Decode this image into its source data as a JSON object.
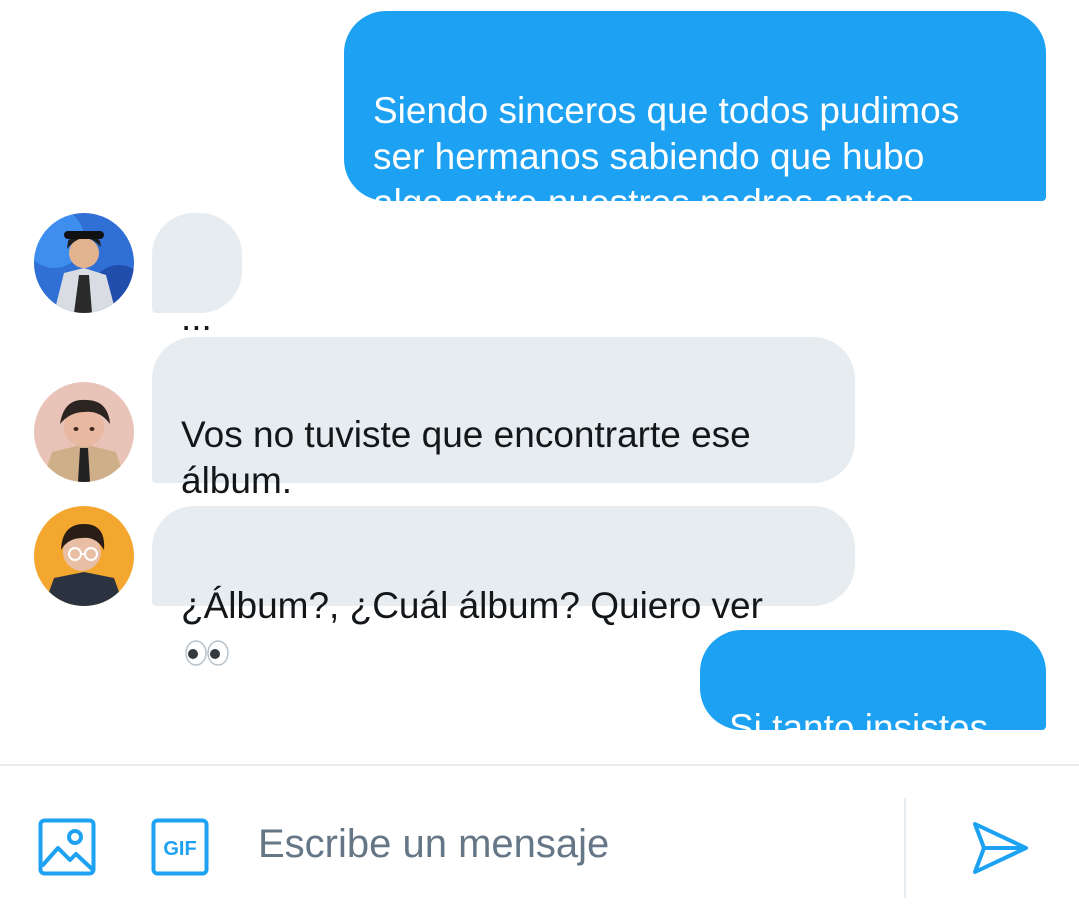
{
  "conversation": {
    "messages": [
      {
        "direction": "outgoing",
        "text": "Siendo sinceros que todos pudimos\nser hermanos sabiendo que hubo\nalgo entre nuestros padres antes."
      },
      {
        "direction": "incoming",
        "avatar": "avatar-blue-coat-character",
        "text": "..."
      },
      {
        "direction": "incoming",
        "avatar": "avatar-beige-jacket-character",
        "text": "Vos no tuviste que encontrarte ese\nálbum."
      },
      {
        "direction": "incoming",
        "avatar": "avatar-orange-glasses-character",
        "text": "¿Álbum?, ¿Cuál álbum? Quiero ver",
        "emoji": "eyes-emoji"
      },
      {
        "direction": "outgoing",
        "text": "Si tanto insistes."
      }
    ]
  },
  "composer": {
    "image_icon": "image-icon",
    "gif_label": "GIF",
    "placeholder": "Escribe un mensaje",
    "send_icon": "send-icon"
  },
  "colors": {
    "outgoing_bubble": "#1da1f2",
    "incoming_bubble": "#e6ecf0",
    "accent": "#1da1f2"
  }
}
